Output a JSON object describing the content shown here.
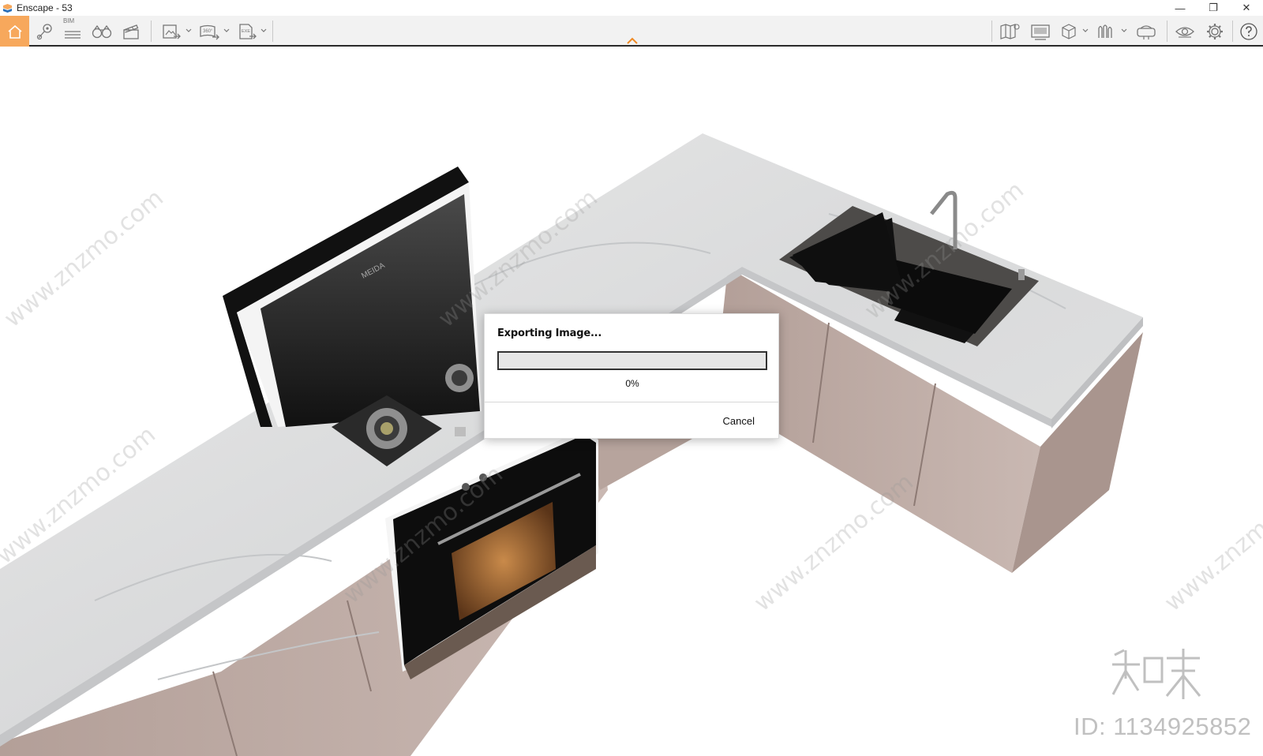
{
  "window": {
    "title": "Enscape - 53",
    "minimize_glyph": "—",
    "restore_glyph": "❐",
    "close_glyph": "✕"
  },
  "toolbar": {
    "bim_label": "BIM",
    "left_icons": [
      "home-icon",
      "location-pin-icon",
      "bim-icon",
      "binoculars-icon",
      "clapperboard-icon",
      "export-image-icon",
      "export-panorama-icon",
      "export-exe-icon"
    ],
    "right_icons": [
      "map-icon",
      "display-icon",
      "cube-icon",
      "visual-presets-icon",
      "vr-headset-icon",
      "eye-icon",
      "gear-icon",
      "help-icon"
    ],
    "panorama_label": "360°",
    "exe_label": "EXE",
    "accent_color": "#f7a85c"
  },
  "dialog": {
    "title": "Exporting Image...",
    "progress_percent": 0,
    "progress_text": "0%",
    "cancel_label": "Cancel"
  },
  "watermark": {
    "site_text": "www.znzmo.com",
    "brand_text": "知末",
    "id_text": "ID: 1134925852"
  }
}
